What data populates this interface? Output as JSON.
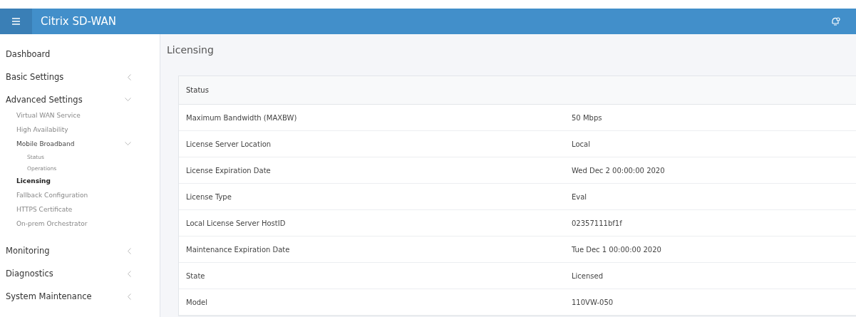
{
  "header": {
    "title": "Citrix SD-WAN"
  },
  "sidebar": {
    "items": [
      {
        "label": "Dashboard",
        "selected": false
      },
      {
        "label": "Basic Settings",
        "selected": false,
        "expanded": false
      },
      {
        "label": "Advanced Settings",
        "selected": false,
        "expanded": true,
        "children": [
          {
            "label": "Virtual WAN Service",
            "selected": false
          },
          {
            "label": "High Availability",
            "selected": false
          },
          {
            "label": "Mobile Broadband",
            "selected": false,
            "expanded": true,
            "children": [
              {
                "label": "Status",
                "selected": false
              },
              {
                "label": "Operations",
                "selected": false
              }
            ]
          },
          {
            "label": "Licensing",
            "selected": true
          },
          {
            "label": "Fallback Configuration",
            "selected": false
          },
          {
            "label": "HTTPS Certificate",
            "selected": false
          },
          {
            "label": "On-prem Orchestrator",
            "selected": false
          }
        ]
      },
      {
        "label": "Monitoring",
        "selected": false,
        "expanded": false
      },
      {
        "label": "Diagnostics",
        "selected": false,
        "expanded": false
      },
      {
        "label": "System Maintenance",
        "selected": false,
        "expanded": false
      }
    ]
  },
  "page": {
    "title": "Licensing"
  },
  "table": {
    "heading": "Status",
    "rows": [
      {
        "label": "Maximum Bandwidth (MAXBW)",
        "value": "50 Mbps"
      },
      {
        "label": "License Server Location",
        "value": "Local"
      },
      {
        "label": "License Expiration Date",
        "value": "Wed Dec 2 00:00:00 2020"
      },
      {
        "label": "License Type",
        "value": "Eval"
      },
      {
        "label": "Local License Server HostID",
        "value": "02357111bf1f"
      },
      {
        "label": "Maintenance Expiration Date",
        "value": "Tue Dec 1 00:00:00 2020"
      },
      {
        "label": "State",
        "value": "Licensed"
      },
      {
        "label": "Model",
        "value": "110VW-050"
      }
    ]
  }
}
